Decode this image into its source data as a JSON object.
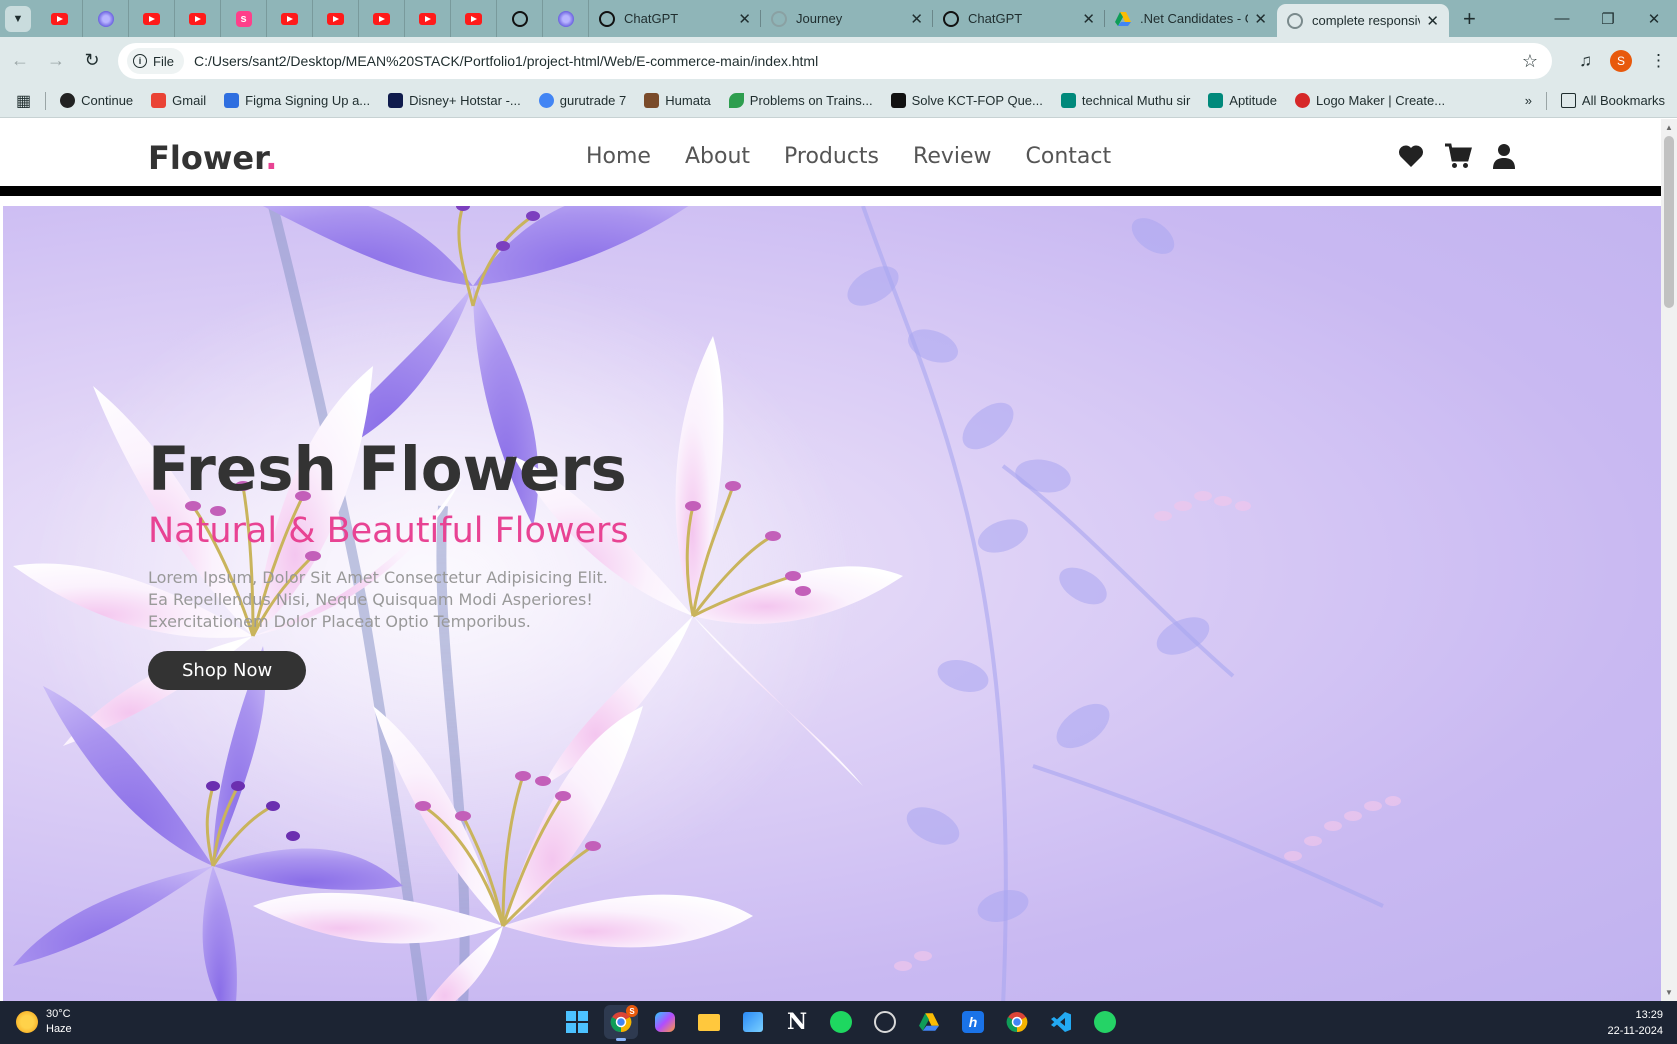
{
  "browser": {
    "pinned_tabs": [
      "youtube-icon",
      "ai-orb-icon",
      "youtube-icon",
      "youtube-icon",
      "s-brand-icon",
      "youtube-icon",
      "youtube-icon",
      "youtube-icon",
      "youtube-icon",
      "youtube-icon",
      "chatgpt-icon",
      "ai-orb-icon"
    ],
    "tabs": [
      {
        "title": "ChatGPT",
        "icon": "chatgpt-icon"
      },
      {
        "title": "Journey",
        "icon": "loading-icon"
      },
      {
        "title": "ChatGPT",
        "icon": "chatgpt-icon"
      },
      {
        "title": ".Net Candidates - G",
        "icon": "google-drive-icon"
      },
      {
        "title": "complete responsiv",
        "icon": "globe-icon",
        "active": true
      }
    ],
    "new_tab_label": "+",
    "address": {
      "chip_label": "File",
      "url": "C:/Users/sant2/Desktop/MEAN%20STACK/Portfolio1/project-html/Web/E-commerce-main/index.html"
    },
    "profile_initial": "S",
    "bookmarks": [
      {
        "label": "Continue",
        "icon": "continue-icon",
        "color": "#222222"
      },
      {
        "label": "Gmail",
        "icon": "gmail-icon",
        "color": "#ea4335"
      },
      {
        "label": "Figma Signing Up a...",
        "icon": "figma-m-icon",
        "color": "#2f6fe0"
      },
      {
        "label": "Disney+ Hotstar -...",
        "icon": "hotstar-icon",
        "color": "#0f1b4c"
      },
      {
        "label": "gurutrade 7",
        "icon": "google-g-icon",
        "color": "#4285f4"
      },
      {
        "label": "Humata",
        "icon": "humata-icon",
        "color": "#7a4b2a"
      },
      {
        "label": "Problems on Trains...",
        "icon": "leaf-icon",
        "color": "#2e9e4f"
      },
      {
        "label": "Solve KCT-FOP Que...",
        "icon": "notion-icon",
        "color": "#111111"
      },
      {
        "label": "technical Muthu sir",
        "icon": "meet-icon",
        "color": "#00897b"
      },
      {
        "label": "Aptitude",
        "icon": "meet-icon",
        "color": "#00897b"
      },
      {
        "label": "Logo Maker | Create...",
        "icon": "chili-icon",
        "color": "#d62828"
      }
    ],
    "all_bookmarks_label": "All Bookmarks"
  },
  "site": {
    "logo_text": "Flower",
    "logo_dot": ".",
    "nav": [
      "Home",
      "About",
      "Products",
      "Review",
      "Contact"
    ],
    "header_icons": [
      "heart-icon",
      "cart-icon",
      "user-icon"
    ],
    "hero": {
      "title": "Fresh Flowers",
      "subtitle": "Natural & Beautiful Flowers",
      "text": "Lorem Ipsum, Dolor Sit Amet Consectetur Adipisicing Elit. Ea Repellendus Nisi, Neque Quisquam Modi Asperiores! Exercitationem Dolor Placeat Optio Temporibus.",
      "button": "Shop Now"
    },
    "colors": {
      "accent": "#e84393",
      "dark": "#333333"
    }
  },
  "taskbar": {
    "weather_temp": "30°C",
    "weather_desc": "Haze",
    "time": "13:29",
    "date": "22-11-2024",
    "chrome_badge": "S"
  }
}
